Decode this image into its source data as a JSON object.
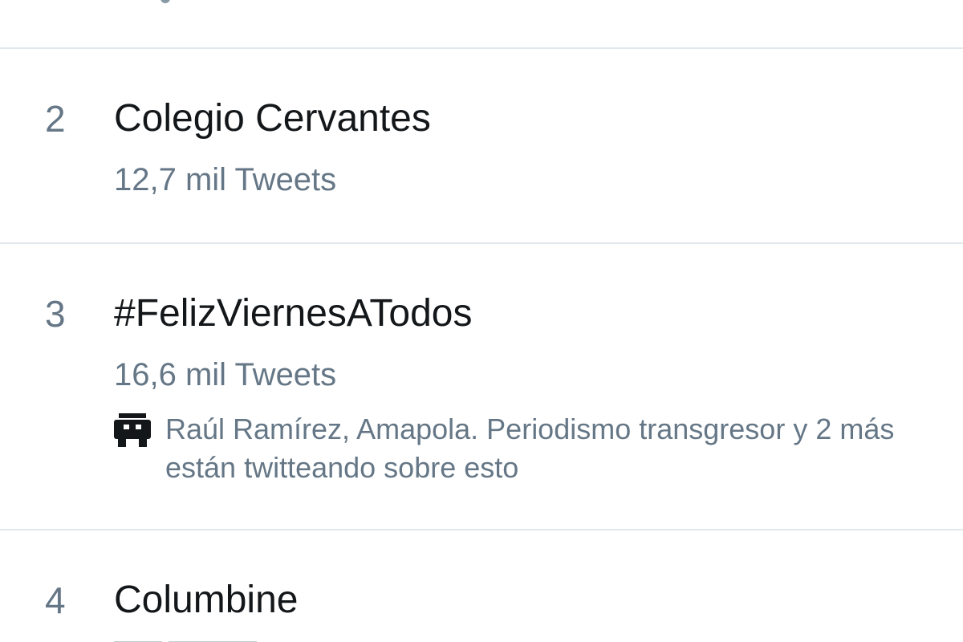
{
  "trends": [
    {
      "rank": "2",
      "name": "Colegio Cervantes",
      "tweet_count": "12,7 mil Tweets"
    },
    {
      "rank": "3",
      "name": "#FelizViernesATodos",
      "tweet_count": "16,6 mil Tweets",
      "context_icon": "bot-avatar-icon",
      "context_text": "Raúl Ramírez, Amapola. Periodismo transgresor y 2 más están twitteando sobre esto"
    },
    {
      "rank": "4",
      "name": "Columbine"
    }
  ],
  "colors": {
    "title": "#14171a",
    "secondary": "#657786",
    "divider": "#e1e8ed",
    "background": "#ffffff"
  }
}
